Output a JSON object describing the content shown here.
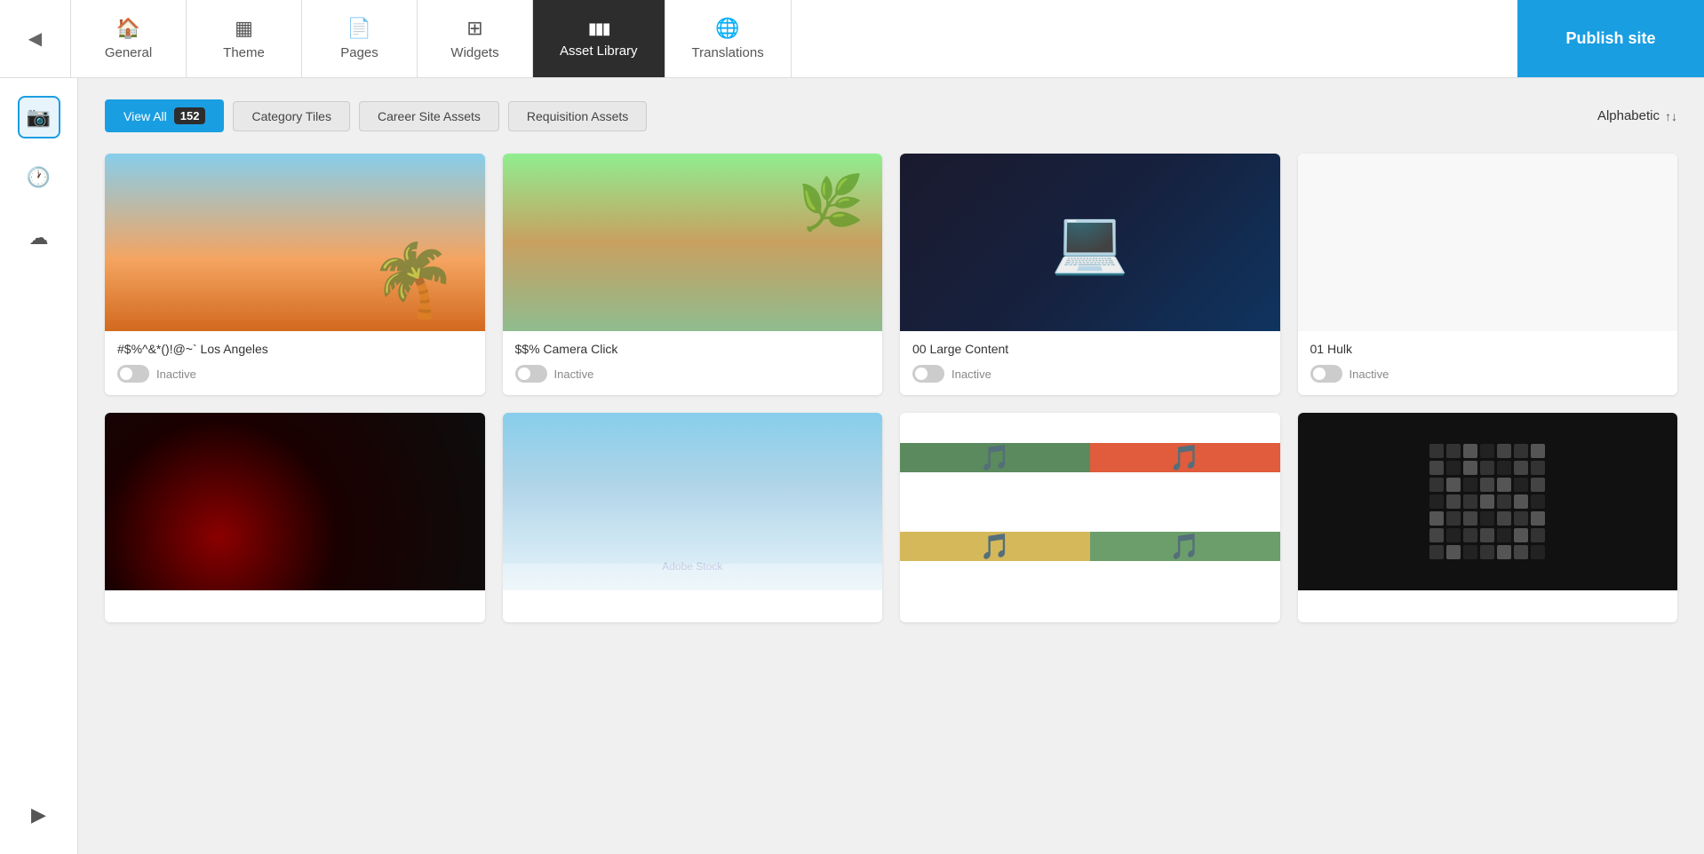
{
  "nav": {
    "back_icon": "◀",
    "items": [
      {
        "id": "general",
        "label": "General",
        "icon": "🏠",
        "active": false
      },
      {
        "id": "theme",
        "label": "Theme",
        "icon": "▦",
        "active": false
      },
      {
        "id": "pages",
        "label": "Pages",
        "icon": "📄",
        "active": false
      },
      {
        "id": "widgets",
        "label": "Widgets",
        "icon": "⊞",
        "active": false
      },
      {
        "id": "asset-library",
        "label": "Asset Library",
        "icon": "▮▮▮",
        "active": true
      },
      {
        "id": "translations",
        "label": "Translations",
        "icon": "🌐",
        "active": false
      }
    ],
    "publish_label": "Publish site"
  },
  "sidebar": {
    "icons": [
      {
        "id": "camera",
        "icon": "📷",
        "active": true
      },
      {
        "id": "clock",
        "icon": "🕐",
        "active": false
      },
      {
        "id": "upload",
        "icon": "☁",
        "active": false
      }
    ],
    "bottom_icon": {
      "id": "arrow",
      "icon": "▶"
    }
  },
  "filters": {
    "buttons": [
      {
        "id": "view-all",
        "label": "View All",
        "badge": "152",
        "active": true
      },
      {
        "id": "category-tiles",
        "label": "Category Tiles",
        "active": false
      },
      {
        "id": "career-site-assets",
        "label": "Career Site Assets",
        "active": false
      },
      {
        "id": "requisition-assets",
        "label": "Requisition Assets",
        "active": false
      }
    ],
    "sort_label": "Alphabetic",
    "sort_icon": "↑↓"
  },
  "assets": [
    {
      "id": "asset-1",
      "title": "#$%^&*()!@~` Los Angeles",
      "status": "Inactive",
      "image_type": "la"
    },
    {
      "id": "asset-2",
      "title": "$$% Camera Click",
      "status": "Inactive",
      "image_type": "camera"
    },
    {
      "id": "asset-3",
      "title": "00 Large Content",
      "status": "Inactive",
      "image_type": "content"
    },
    {
      "id": "asset-4",
      "title": "01 Hulk",
      "status": "Inactive",
      "image_type": "hulk"
    },
    {
      "id": "asset-5",
      "title": "",
      "status": "",
      "image_type": "dark"
    },
    {
      "id": "asset-6",
      "title": "",
      "status": "",
      "image_type": "sky"
    },
    {
      "id": "asset-7",
      "title": "",
      "status": "",
      "image_type": "cassette"
    },
    {
      "id": "asset-8",
      "title": "",
      "status": "",
      "image_type": "qr"
    }
  ]
}
